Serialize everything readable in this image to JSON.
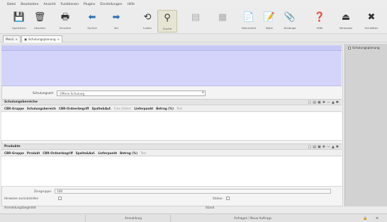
{
  "menu": [
    "Datei",
    "Bearbeiten",
    "Ansicht",
    "Funktionen",
    "Plugins",
    "Einstellungen",
    "Hilfe"
  ],
  "toolbar": [
    {
      "label": "Speichern",
      "icon": "save-icon",
      "glyph": "💾"
    },
    {
      "label": "Löschen",
      "icon": "delete-icon",
      "glyph": "🗑"
    },
    {
      "label": "Drucken",
      "icon": "print-icon",
      "glyph": "🖶"
    },
    {
      "label": "Zurück",
      "icon": "arrow-back-icon",
      "glyph": "⬅"
    },
    {
      "label": "Vor",
      "icon": "arrow-forward-icon",
      "glyph": "➡"
    },
    {
      "label": "Laden",
      "icon": "load-icon",
      "glyph": "⟲"
    },
    {
      "label": "Suche",
      "icon": "search-icon",
      "glyph": "⚲"
    },
    {
      "label": "",
      "icon": "disabled-icon-1",
      "glyph": "▤"
    },
    {
      "label": "",
      "icon": "disabled-icon-2",
      "glyph": "▦"
    },
    {
      "label": "Dokument",
      "icon": "document-icon",
      "glyph": "📄"
    },
    {
      "label": "Notiz",
      "icon": "note-icon",
      "glyph": "📝"
    },
    {
      "label": "Anhänge",
      "icon": "attachment-icon",
      "glyph": "📎"
    },
    {
      "label": "Hilfe",
      "icon": "help-icon",
      "glyph": "❓"
    },
    {
      "label": "Verlassen",
      "icon": "exit-icon",
      "glyph": "⏏"
    },
    {
      "label": "Schließen",
      "icon": "close-icon",
      "glyph": "✖"
    }
  ],
  "tabs": {
    "first": "Menü",
    "active": "Schulungsplanung"
  },
  "rightpanel": {
    "item": "Schulungsplanung"
  },
  "form": {
    "schulungsart_label": "Schulungsart:",
    "schulungsart_value": "Offene Schulung"
  },
  "sections": {
    "s1_title": "Schulungsbereiche",
    "s1_cols": [
      "CBR-Gruppe",
      "Schulungsbereich",
      "CBR-Ordnerbegriff",
      "Spalte&Auf.",
      "Eine Zahlen",
      "Lieferpunkt",
      "Betrag (%)",
      "Text"
    ],
    "s2_title": "Produkte",
    "s2_cols": [
      "CBR-Gruppe",
      "Produkt",
      "CBR-Ordnerbegriff",
      "Spalte&Auf.",
      "Lieferpunkt",
      "Betrag (%)",
      "Text"
    ]
  },
  "bottom": {
    "zinsgruppe_label": "Zinsgruppe:",
    "zinsgruppe_value": "100",
    "hinweise_label": "Hinweise zurückstellen",
    "status_label": "Status:",
    "anmeldung_label": "Anmeldungsbegleitet",
    "erstellt_label": "Stand"
  },
  "status": {
    "left": "",
    "mid1": "Anmeldung",
    "mid2": "Anfragen / Neue Auftrags"
  },
  "colors": {
    "accent": "#d4d4fb",
    "panel": "#d2d2d2"
  }
}
